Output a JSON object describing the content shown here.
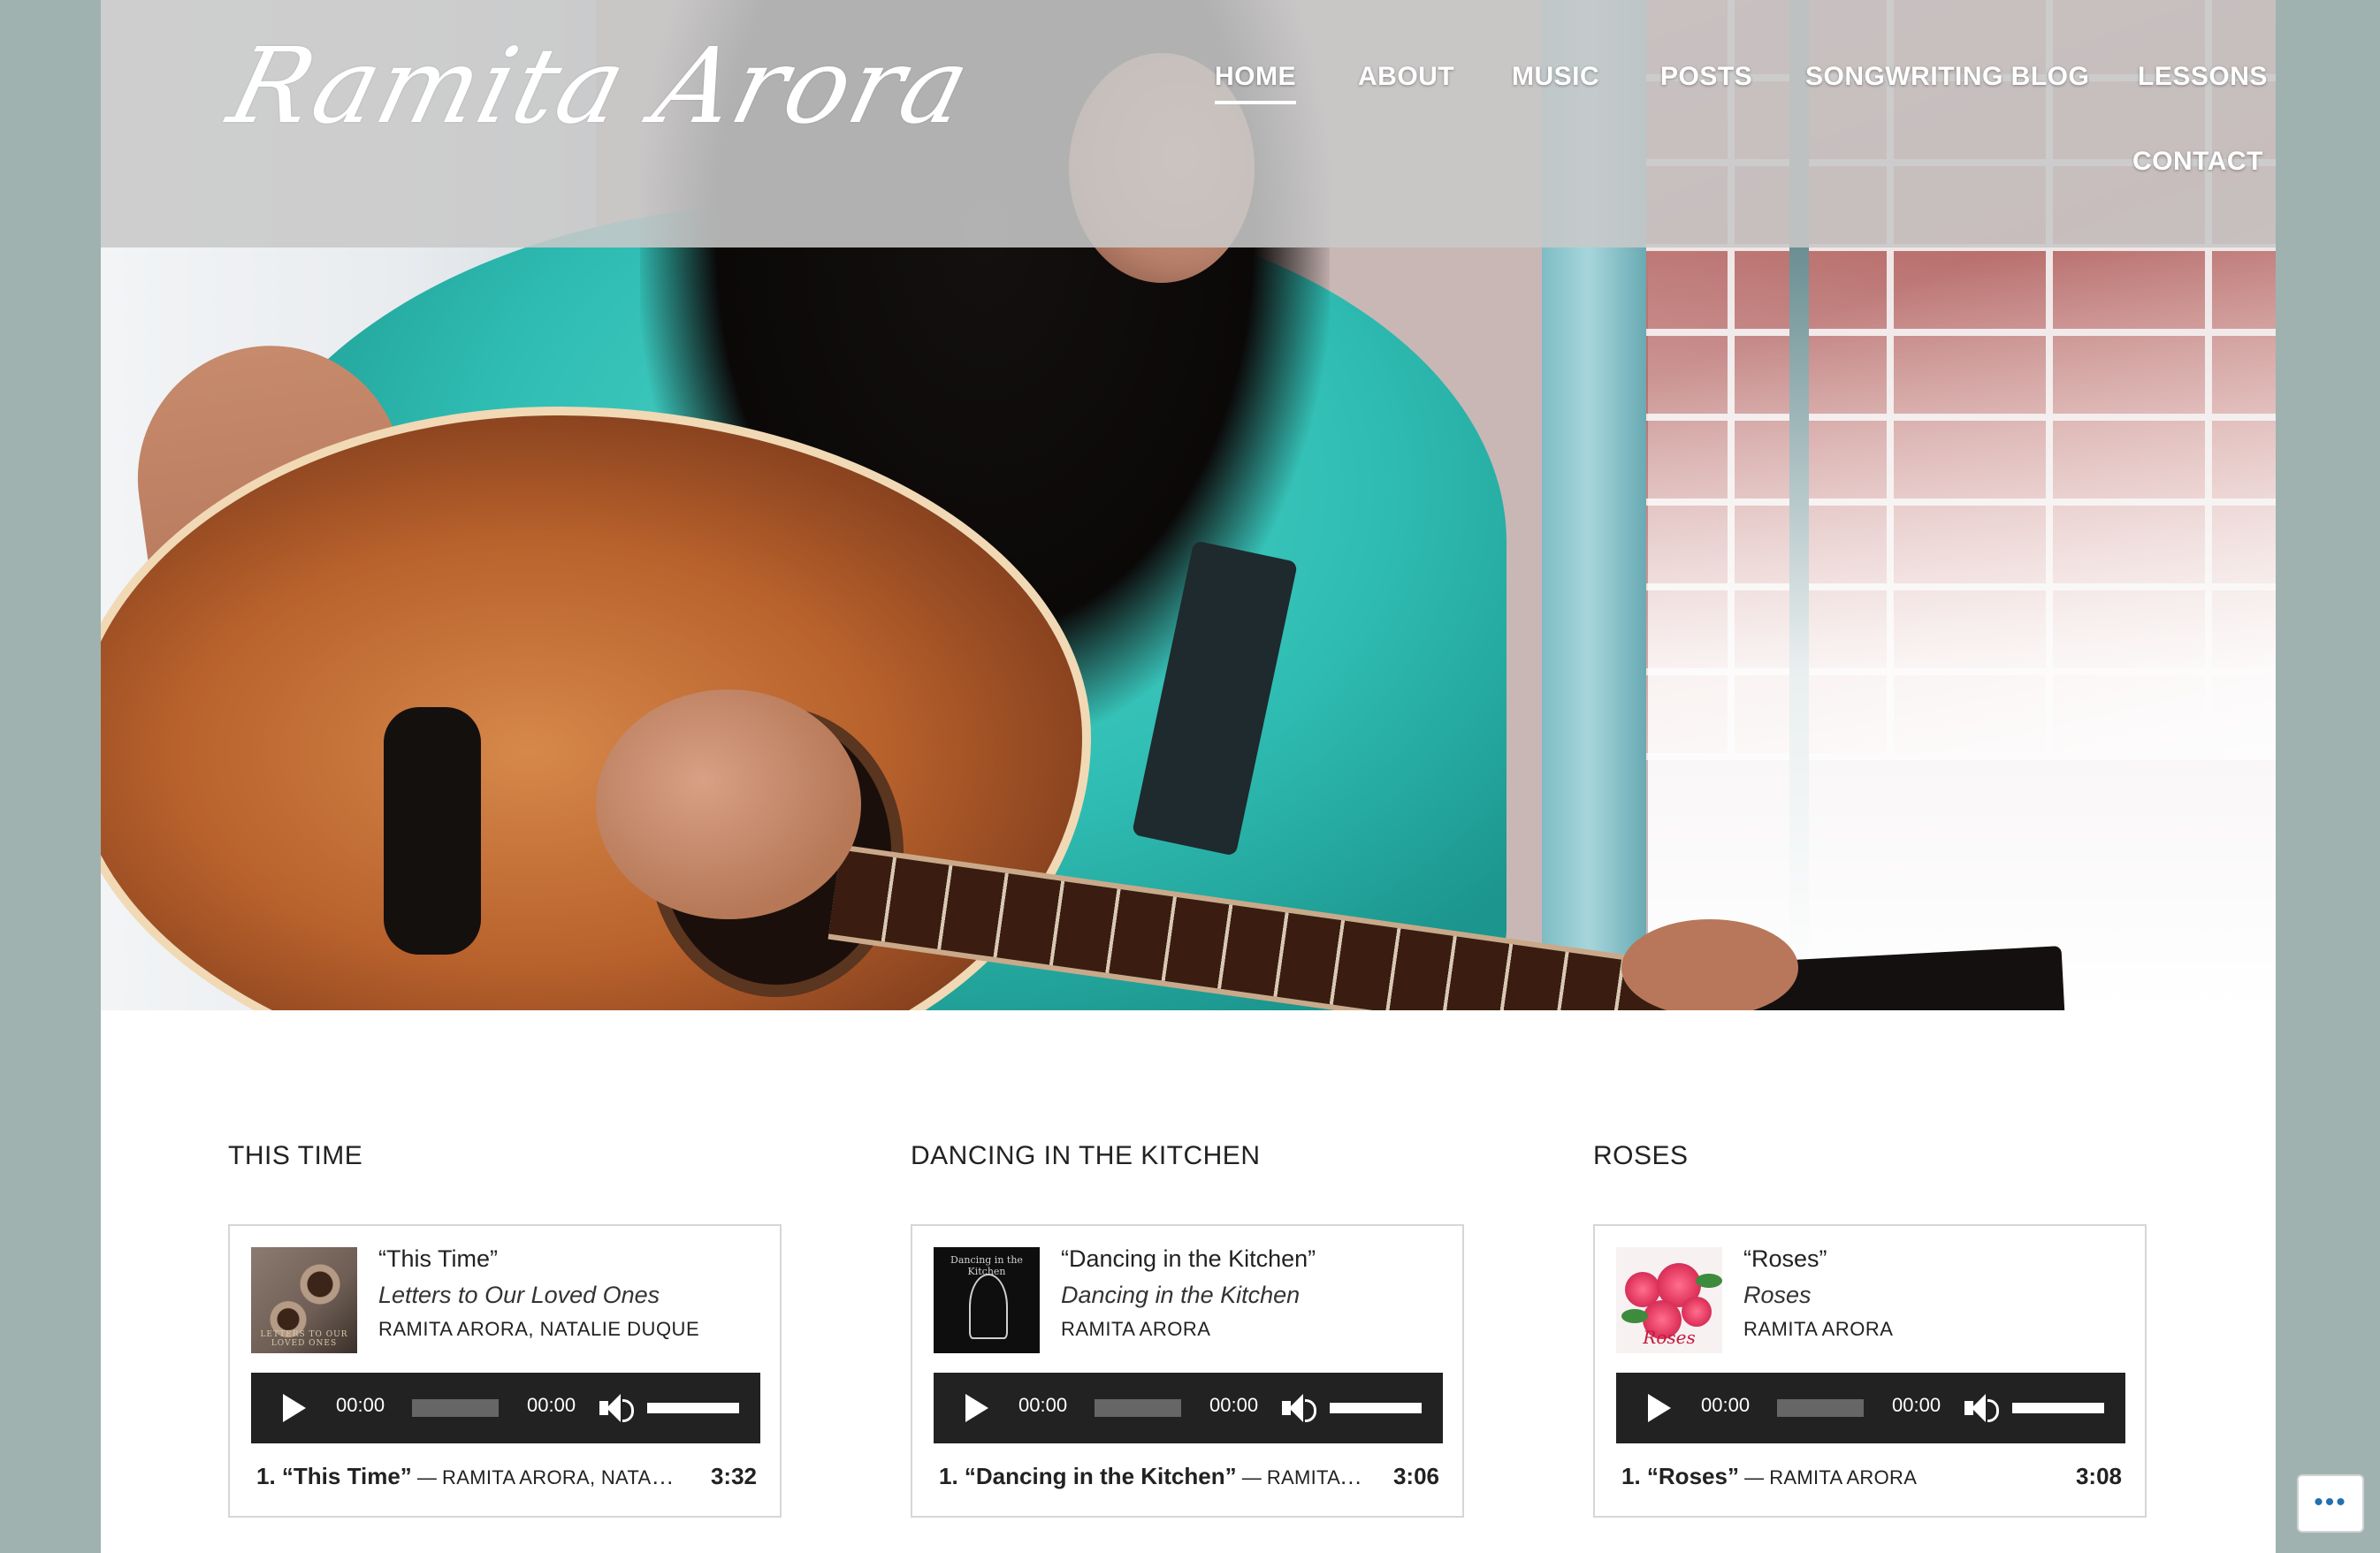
{
  "site": {
    "logo_text": "Ramita Arora"
  },
  "nav": {
    "items": [
      {
        "label": "HOME",
        "active": true
      },
      {
        "label": "ABOUT",
        "active": false
      },
      {
        "label": "MUSIC",
        "active": false
      },
      {
        "label": "POSTS",
        "active": false
      },
      {
        "label": "SONGWRITING BLOG",
        "active": false
      },
      {
        "label": "LESSONS",
        "active": false
      },
      {
        "label": "CONTACT",
        "active": false
      }
    ]
  },
  "playlists": [
    {
      "heading": "THIS TIME",
      "song": "“This Time”",
      "album": "Letters to Our Loved Ones",
      "artist": "RAMITA ARORA, NATALIE DUQUE",
      "cover_text": "LETTERS TO OUR LOVED ONES",
      "current_time": "00:00",
      "duration_time": "00:00",
      "track_title": "1. “This Time”",
      "track_sep": " — ",
      "track_artists": "RAMITA ARORA, NATALIE DUQUE",
      "track_length": "3:32"
    },
    {
      "heading": "DANCING IN THE KITCHEN",
      "song": "“Dancing in the Kitchen”",
      "album": "Dancing in the Kitchen",
      "artist": "RAMITA ARORA",
      "cover_text": "Dancing in the Kitchen",
      "current_time": "00:00",
      "duration_time": "00:00",
      "track_title": "1. “Dancing in the Kitchen”",
      "track_sep": " — ",
      "track_artists": "RAMITA ARORA",
      "track_length": "3:06"
    },
    {
      "heading": "ROSES",
      "song": "“Roses”",
      "album": "Roses",
      "artist": "RAMITA ARORA",
      "cover_text": "Roses",
      "current_time": "00:00",
      "duration_time": "00:00",
      "track_title": "1. “Roses”",
      "track_sep": " — ",
      "track_artists": "RAMITA ARORA",
      "track_length": "3:08"
    }
  ],
  "more_button": {
    "label": "•••"
  },
  "colors": {
    "page_background": "#9fb2b0",
    "header_overlay": "#c8c8c8",
    "player_bar": "#222222",
    "more_dots": "#2271b1"
  },
  "icons": {
    "play": "play-icon",
    "volume": "volume-icon",
    "more": "ellipsis-icon"
  }
}
